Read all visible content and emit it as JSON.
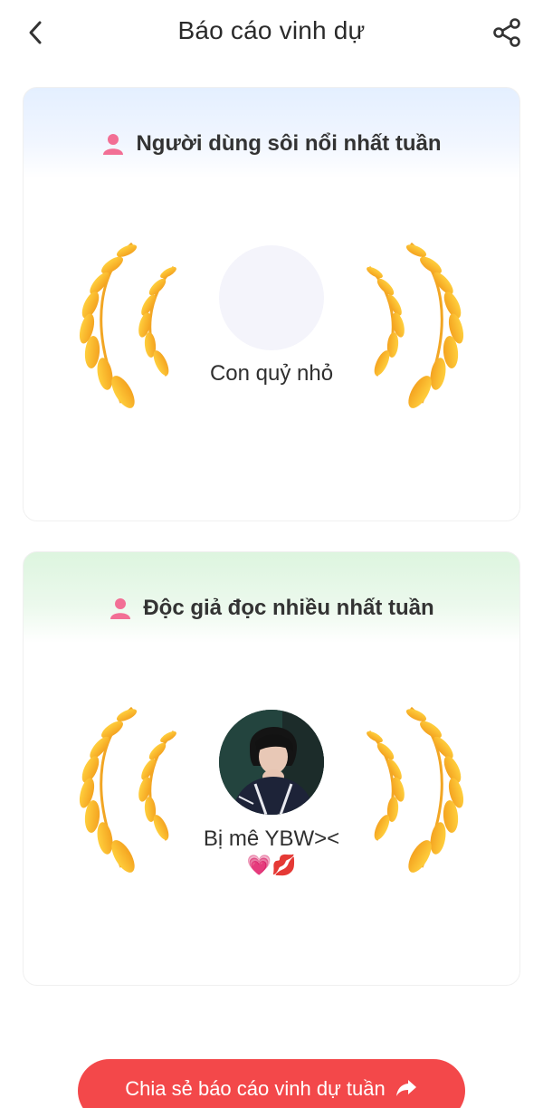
{
  "header": {
    "title": "Báo cáo vinh dự"
  },
  "cards": [
    {
      "title": "Người dùng sôi nổi nhất tuần",
      "user_name": "Con quỷ nhỏ",
      "accent": "#f06a8f"
    },
    {
      "title": "Độc giả đọc nhiều nhất tuần",
      "user_name": "Bị mê YBW><",
      "emojis": "💗💋",
      "accent": "#f06a8f"
    }
  ],
  "share_button": {
    "label": "Chia sẻ báo cáo vinh dự tuần"
  },
  "icons": {
    "back": "chevron-left-icon",
    "share": "share-icon",
    "user": "user-icon",
    "laurel": "laurel-wreath-icon",
    "share_arrow": "share-arrow-icon"
  },
  "colors": {
    "primary": "#f3484a",
    "laurel_light": "#ffd24a",
    "laurel_dark": "#f59a1b"
  }
}
